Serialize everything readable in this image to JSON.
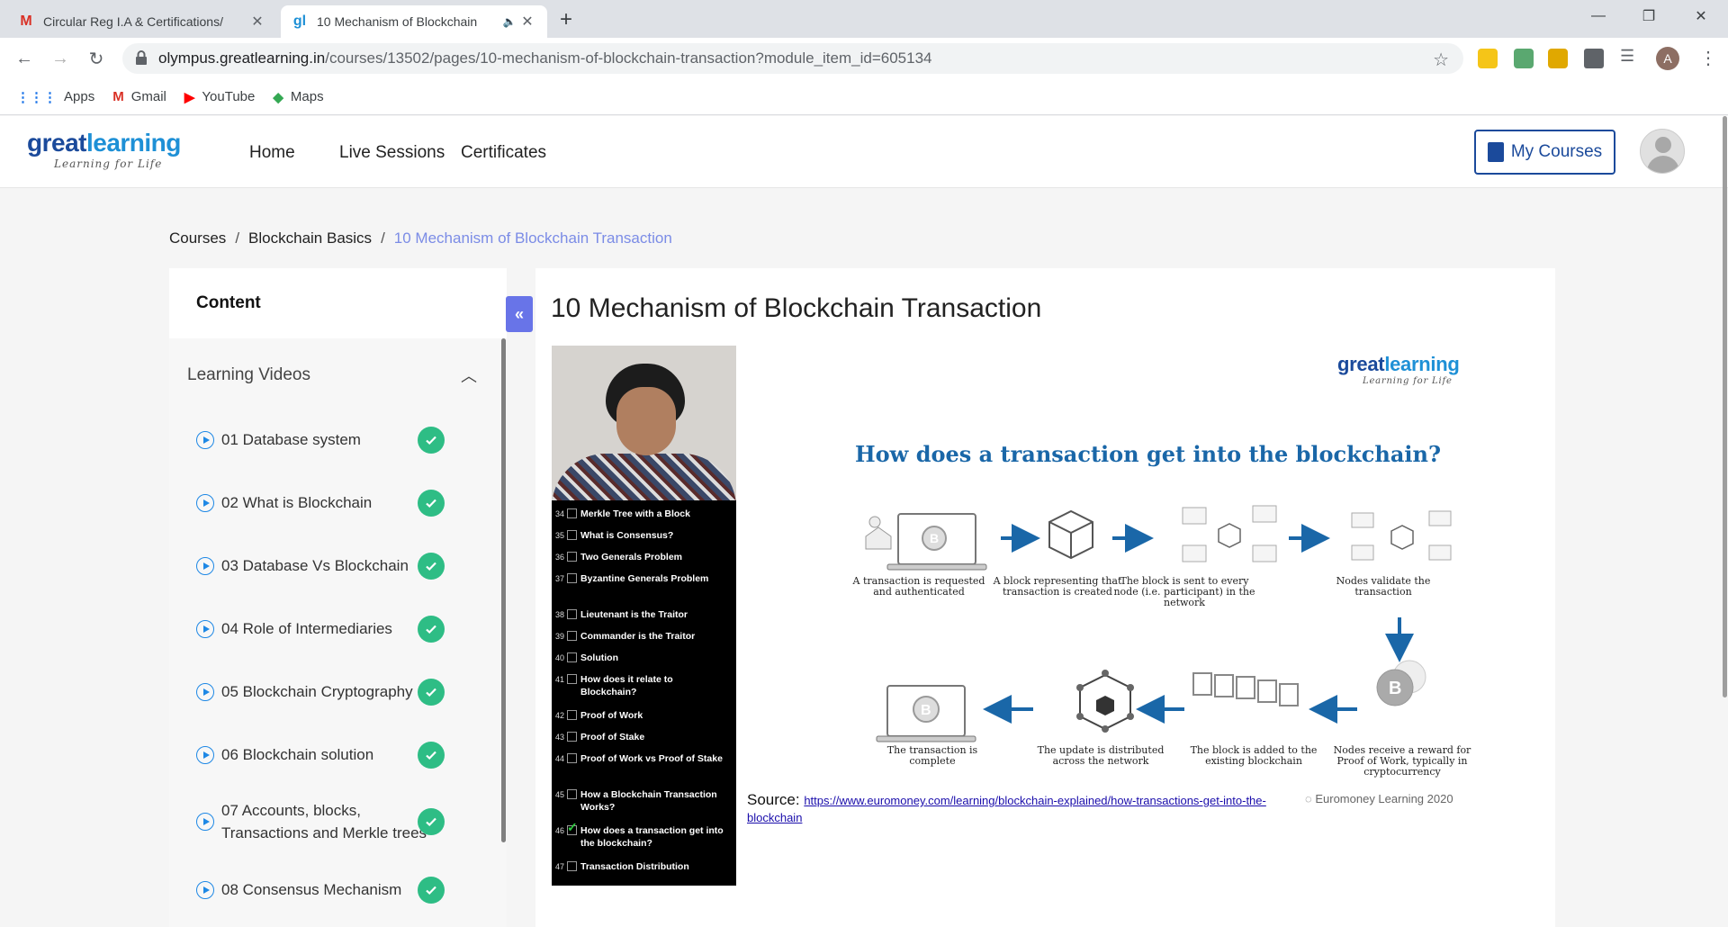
{
  "browser": {
    "tabs": [
      {
        "title": "Circular Reg I.A & Certifications/",
        "favicon": "M",
        "active": false
      },
      {
        "title": "10 Mechanism of Blockchain",
        "favicon": "gl",
        "active": true
      }
    ],
    "url_host": "olympus.greatlearning.in",
    "url_path": "/courses/13502/pages/10-mechanism-of-blockchain-transaction?module_item_id=605134",
    "profile_initial": "A",
    "bookmarks": [
      {
        "label": "Apps",
        "icon": "apps-grid-icon"
      },
      {
        "label": "Gmail",
        "icon": "gmail-icon"
      },
      {
        "label": "YouTube",
        "icon": "youtube-icon"
      },
      {
        "label": "Maps",
        "icon": "maps-icon"
      }
    ]
  },
  "site": {
    "logo_main_a": "great",
    "logo_main_b": "learning",
    "logo_tagline": "Learning for Life",
    "nav": [
      "Home",
      "Live Sessions",
      "Certificates"
    ],
    "my_courses": "My Courses"
  },
  "breadcrumb": {
    "items": [
      "Courses",
      "Blockchain Basics",
      "10 Mechanism of Blockchain Transaction"
    ],
    "separator": "/"
  },
  "sidebar": {
    "title": "Content",
    "section": "Learning Videos",
    "items": [
      "01 Database system",
      "02 What is Blockchain",
      "03 Database Vs Blockchain",
      "04 Role of Intermediaries",
      "05 Blockchain Cryptography",
      "06 Blockchain solution",
      "07 Accounts, blocks, Transactions and Merkle trees",
      "08 Consensus Mechanism"
    ]
  },
  "main": {
    "title": "10 Mechanism of Blockchain Transaction"
  },
  "video_overlay": [
    {
      "n": "34",
      "t": "Merkle Tree with a Block",
      "done": false
    },
    {
      "n": "35",
      "t": "What is Consensus?",
      "done": false
    },
    {
      "n": "36",
      "t": "Two Generals Problem",
      "done": false
    },
    {
      "n": "37",
      "t": "Byzantine Generals Problem",
      "done": false
    },
    {
      "n": "38",
      "t": "Lieutenant is the Traitor",
      "done": false
    },
    {
      "n": "39",
      "t": "Commander is the Traitor",
      "done": false
    },
    {
      "n": "40",
      "t": "Solution",
      "done": false
    },
    {
      "n": "41",
      "t": "How does it relate to Blockchain?",
      "done": false
    },
    {
      "n": "42",
      "t": "Proof of Work",
      "done": false
    },
    {
      "n": "43",
      "t": "Proof of Stake",
      "done": false
    },
    {
      "n": "44",
      "t": "Proof of Work vs Proof of Stake",
      "done": false
    },
    {
      "n": "45",
      "t": "How a Blockchain Transaction Works?",
      "done": false
    },
    {
      "n": "46",
      "t": "How does a transaction get into the blockchain?",
      "done": true
    },
    {
      "n": "47",
      "t": "Transaction Distribution",
      "done": false
    }
  ],
  "slide": {
    "logo_main_a": "great",
    "logo_main_b": "learning",
    "logo_tagline": "Learning for Life",
    "heading": "How does a transaction get into the blockchain?",
    "steps": [
      "A transaction is requested and authenticated",
      "A block representing that transaction is created",
      "The block is sent to every node (i.e. participant) in the network",
      "Nodes validate the transaction",
      "Nodes receive a reward for Proof of Work, typically in cryptocurrency",
      "The block is added to the existing blockchain",
      "The update is distributed across the network",
      "The transaction is complete"
    ],
    "source_label": "Source:",
    "source_url": "https://www.euromoney.com/learning/blockchain-explained/how-transactions-get-into-the-blockchain",
    "copyright": "Euromoney Learning 2020"
  },
  "colors": {
    "brand_dark": "#1b4a9b",
    "brand_light": "#1e90d6",
    "check_green": "#2ebd85",
    "collapse_btn": "#6874e8",
    "breadcrumb_current": "#7b8ce6",
    "slide_heading": "#1a67a8"
  }
}
